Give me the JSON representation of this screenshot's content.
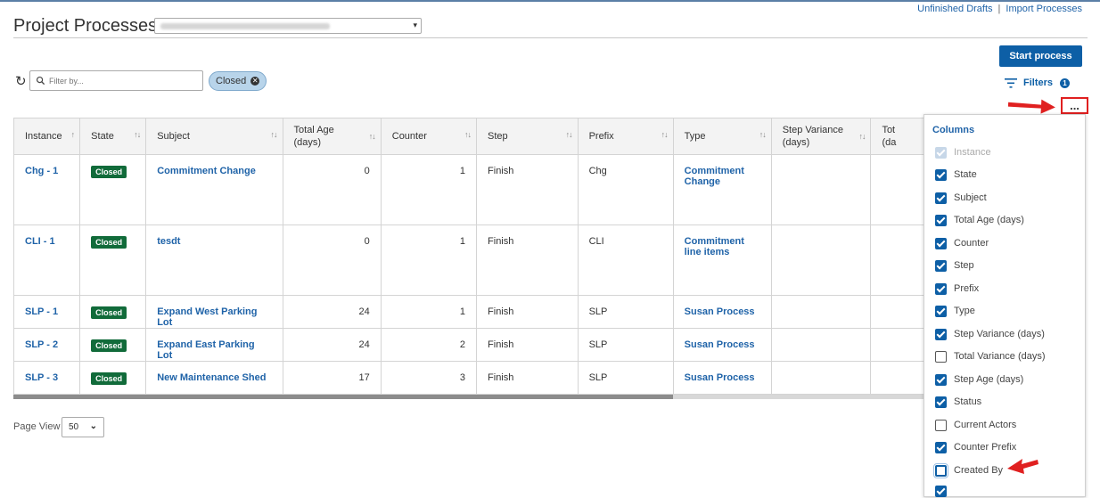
{
  "header": {
    "title": "Project Processes",
    "unfinished_drafts": "Unfinished Drafts",
    "separator": "|",
    "import_processes": "Import Processes"
  },
  "toolbar": {
    "start_process": "Start process",
    "filter_placeholder": "Filter by...",
    "chip_label": "Closed",
    "filters_label": "Filters",
    "filters_count": "1",
    "more_label": "..."
  },
  "table": {
    "headers": [
      "Instance",
      "State",
      "Subject",
      "Total Age (days)",
      "Counter",
      "Step",
      "Prefix",
      "Type",
      "Step Variance (days)",
      "Tot (da"
    ],
    "rows": [
      {
        "instance": "Chg - 1",
        "state": "Closed",
        "subject": "Commitment Change",
        "total_age": "0",
        "counter": "1",
        "step": "Finish",
        "prefix": "Chg",
        "type": "Commitment Change"
      },
      {
        "instance": "CLI - 1",
        "state": "Closed",
        "subject": "tesdt",
        "total_age": "0",
        "counter": "1",
        "step": "Finish",
        "prefix": "CLI",
        "type": "Commitment line items"
      },
      {
        "instance": "SLP - 1",
        "state": "Closed",
        "subject": "Expand West Parking Lot",
        "total_age": "24",
        "counter": "1",
        "step": "Finish",
        "prefix": "SLP",
        "type": "Susan Process"
      },
      {
        "instance": "SLP - 2",
        "state": "Closed",
        "subject": "Expand East Parking Lot",
        "total_age": "24",
        "counter": "2",
        "step": "Finish",
        "prefix": "SLP",
        "type": "Susan Process"
      },
      {
        "instance": "SLP - 3",
        "state": "Closed",
        "subject": "New Maintenance Shed",
        "total_age": "17",
        "counter": "3",
        "step": "Finish",
        "prefix": "SLP",
        "type": "Susan Process"
      }
    ]
  },
  "pagination": {
    "page_view_label": "Page View",
    "page_size": "50"
  },
  "columns_panel": {
    "title": "Columns",
    "options": [
      {
        "label": "Instance",
        "state": "disabled"
      },
      {
        "label": "State",
        "state": "checked"
      },
      {
        "label": "Subject",
        "state": "checked"
      },
      {
        "label": "Total Age (days)",
        "state": "checked"
      },
      {
        "label": "Counter",
        "state": "checked"
      },
      {
        "label": "Step",
        "state": "checked"
      },
      {
        "label": "Prefix",
        "state": "checked"
      },
      {
        "label": "Type",
        "state": "checked"
      },
      {
        "label": "Step Variance (days)",
        "state": "checked"
      },
      {
        "label": "Total Variance (days)",
        "state": "unchecked"
      },
      {
        "label": "Step Age (days)",
        "state": "checked"
      },
      {
        "label": "Status",
        "state": "checked"
      },
      {
        "label": "Current Actors",
        "state": "unchecked"
      },
      {
        "label": "Counter Prefix",
        "state": "checked"
      },
      {
        "label": "Created By",
        "state": "focused"
      }
    ]
  },
  "colors": {
    "primary": "#0d5fa6",
    "link": "#1f63a8",
    "closed_badge": "#116b3a",
    "annotation": "#e02020"
  }
}
